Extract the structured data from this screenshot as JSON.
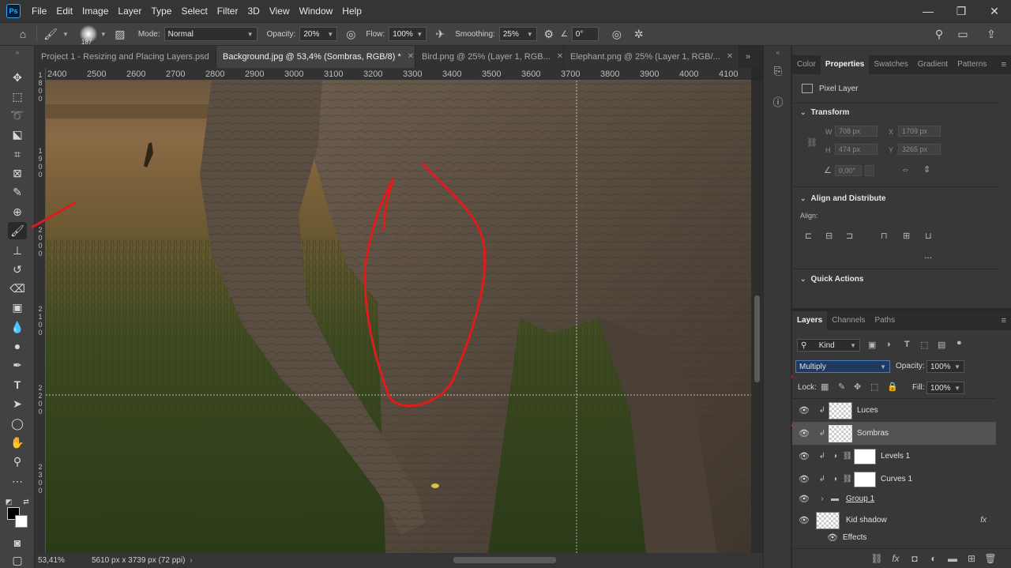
{
  "app_icon": "Ps",
  "menu": [
    "File",
    "Edit",
    "Image",
    "Layer",
    "Type",
    "Select",
    "Filter",
    "3D",
    "View",
    "Window",
    "Help"
  ],
  "window_controls": {
    "minimize": "—",
    "restore": "❐",
    "close": "✕"
  },
  "options": {
    "brush_size": "187",
    "mode_label": "Mode:",
    "mode_value": "Normal",
    "opacity_label": "Opacity:",
    "opacity_value": "20%",
    "flow_label": "Flow:",
    "flow_value": "100%",
    "smoothing_label": "Smoothing:",
    "smoothing_value": "25%",
    "angle_value": "0°"
  },
  "tabs": [
    {
      "label": "Project 1 - Resizing and Placing Layers.psd"
    },
    {
      "label": "Background.jpg @ 53,4% (Sombras, RGB/8) *"
    },
    {
      "label": "Bird.png @ 25% (Layer 1, RGB..."
    },
    {
      "label": "Elephant.png @ 25% (Layer 1, RGB/..."
    }
  ],
  "ruler_top": [
    "2400",
    "2500",
    "2600",
    "2700",
    "2800",
    "2900",
    "3000",
    "3100",
    "3200",
    "3300",
    "3400",
    "3500",
    "3600",
    "3700",
    "3800",
    "3900",
    "4000",
    "4100"
  ],
  "status": {
    "zoom": "53,41%",
    "doc_size": "5610 px x 3739 px (72 ppi)"
  },
  "properties": {
    "tabs": [
      "Color",
      "Properties",
      "Swatches",
      "Gradient",
      "Patterns"
    ],
    "layer_type": "Pixel Layer",
    "transform_title": "Transform",
    "w_label": "W",
    "w_value": "708 px",
    "x_label": "X",
    "x_value": "1709 px",
    "h_label": "H",
    "h_value": "474 px",
    "y_label": "Y",
    "y_value": "3265 px",
    "angle_value": "0,00°",
    "align_title": "Align and Distribute",
    "align_label": "Align:",
    "more": "...",
    "quick_title": "Quick Actions"
  },
  "layers_panel": {
    "tabs": [
      "Layers",
      "Channels",
      "Paths"
    ],
    "filter_kind": "Kind",
    "blend_mode": "Multiply",
    "opacity_label": "Opacity:",
    "opacity_value": "100%",
    "lock_label": "Lock:",
    "fill_label": "Fill:",
    "fill_value": "100%",
    "layers": [
      {
        "name": "Luces"
      },
      {
        "name": "Sombras"
      },
      {
        "name": "Levels 1"
      },
      {
        "name": "Curves 1"
      },
      {
        "name": "Group 1"
      },
      {
        "name": "Kid shadow"
      },
      {
        "name": "Effects"
      }
    ],
    "fx_badge": "fx"
  }
}
